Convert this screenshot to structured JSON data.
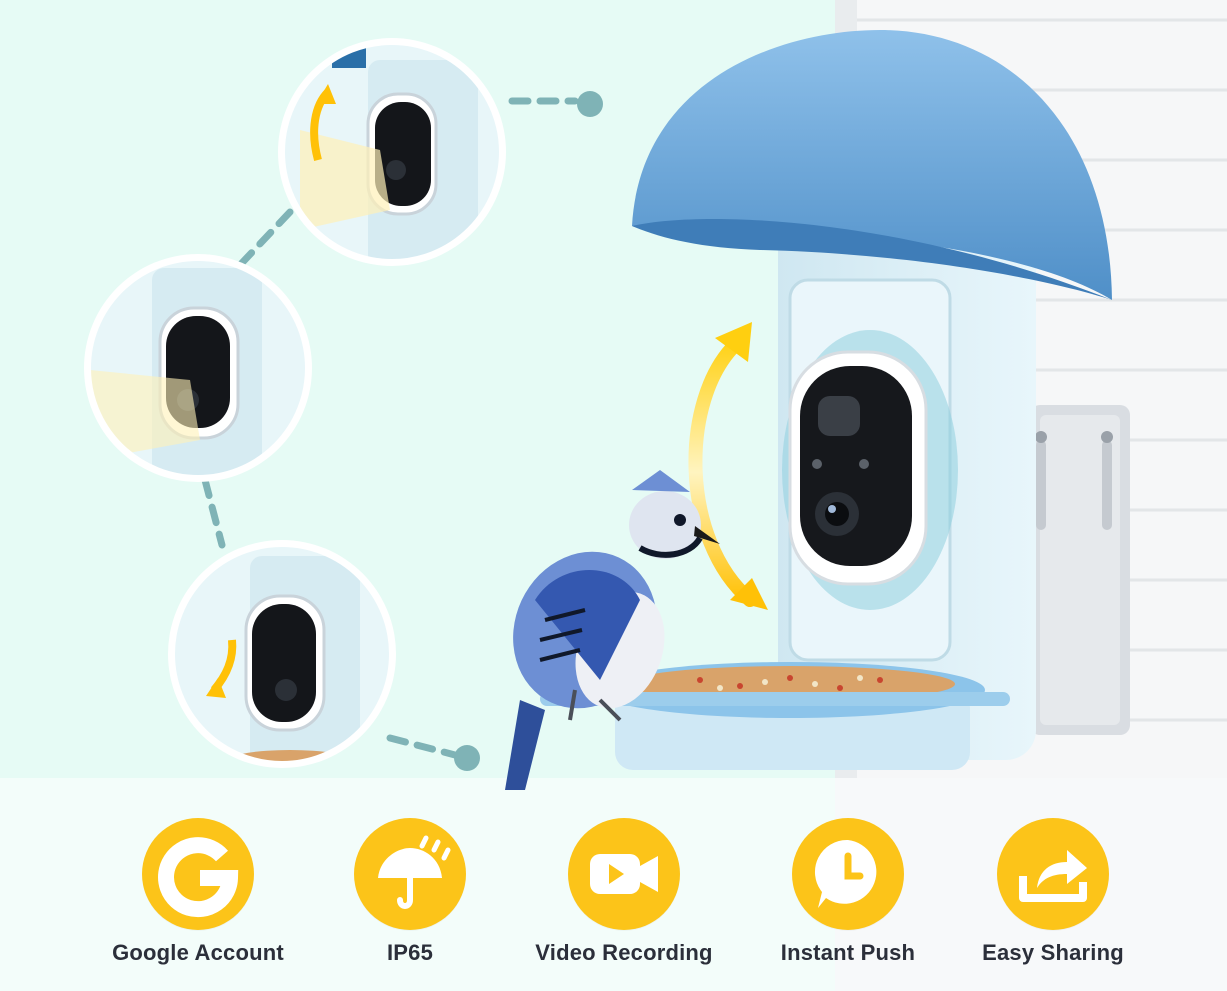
{
  "colors": {
    "background": "#e6fbf5",
    "accent_yellow": "#fcc419",
    "feeder_blue": "#6aa6d8",
    "text_dark": "#2b2f3a"
  },
  "features": [
    {
      "icon": "google-g-icon",
      "label": "Google Account"
    },
    {
      "icon": "umbrella-rain-icon",
      "label": "IP65"
    },
    {
      "icon": "video-camera-icon",
      "label": "Video Recording"
    },
    {
      "icon": "clock-bubble-icon",
      "label": "Instant Push"
    },
    {
      "icon": "share-arrow-icon",
      "label": "Easy Sharing"
    }
  ]
}
